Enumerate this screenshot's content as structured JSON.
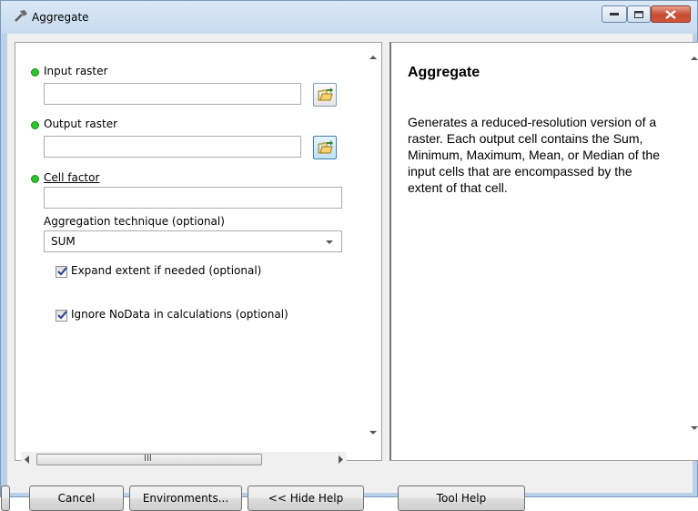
{
  "window": {
    "title": "Aggregate",
    "controls": [
      "minimize-icon",
      "maximize-icon",
      "close-icon"
    ]
  },
  "params": {
    "input_raster_label": "Input raster",
    "input_raster_value": "",
    "output_raster_label": "Output raster",
    "output_raster_value": "",
    "cell_factor_label": "Cell factor",
    "cell_factor_value": "",
    "aggregation_label": "Aggregation technique (optional)",
    "aggregation_value": "SUM",
    "expand_label": "Expand extent if needed (optional)",
    "expand_checked": true,
    "ignore_label": "Ignore NoData in calculations (optional)",
    "ignore_checked": true,
    "required_color": "#2bc42b"
  },
  "scrollbar": {
    "h_thumb_grip": "III"
  },
  "help": {
    "title": "Aggregate",
    "body": "Generates a reduced-resolution version of a raster. Each output cell contains the Sum, Minimum, Maximum, Mean, or Median of the input cells that are encompassed by the extent of that cell."
  },
  "buttons": {
    "cancel": "Cancel",
    "environments": "Environments...",
    "hide_help": "<< Hide Help",
    "tool_help": "Tool Help"
  }
}
